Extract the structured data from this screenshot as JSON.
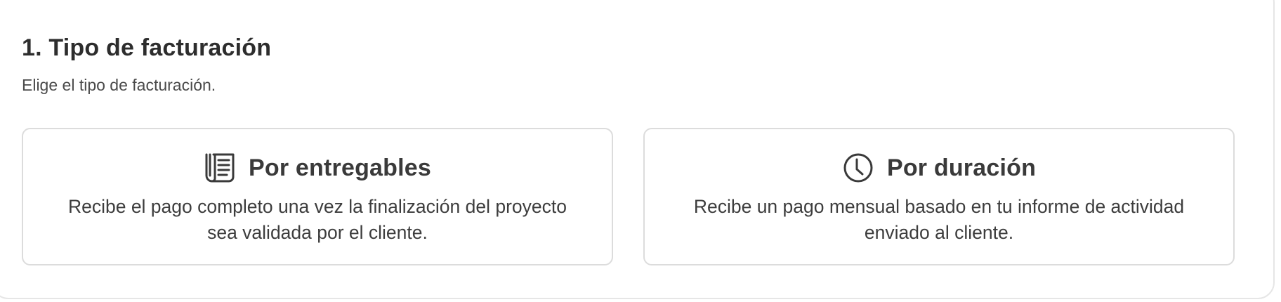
{
  "section": {
    "title": "1. Tipo de facturación",
    "subtitle": "Elige el tipo de facturación."
  },
  "options": [
    {
      "icon": "document-list-icon",
      "title": "Por entregables",
      "description": "Recibe el pago completo una vez la finalización del proyecto sea validada por el cliente."
    },
    {
      "icon": "clock-icon",
      "title": "Por duración",
      "description": "Recibe un pago mensual basado en tu informe de actividad enviado al cliente."
    }
  ],
  "colors": {
    "text_primary": "#2d2d2d",
    "card_border": "#dcdcdc",
    "panel_border": "#e6e6e6"
  }
}
